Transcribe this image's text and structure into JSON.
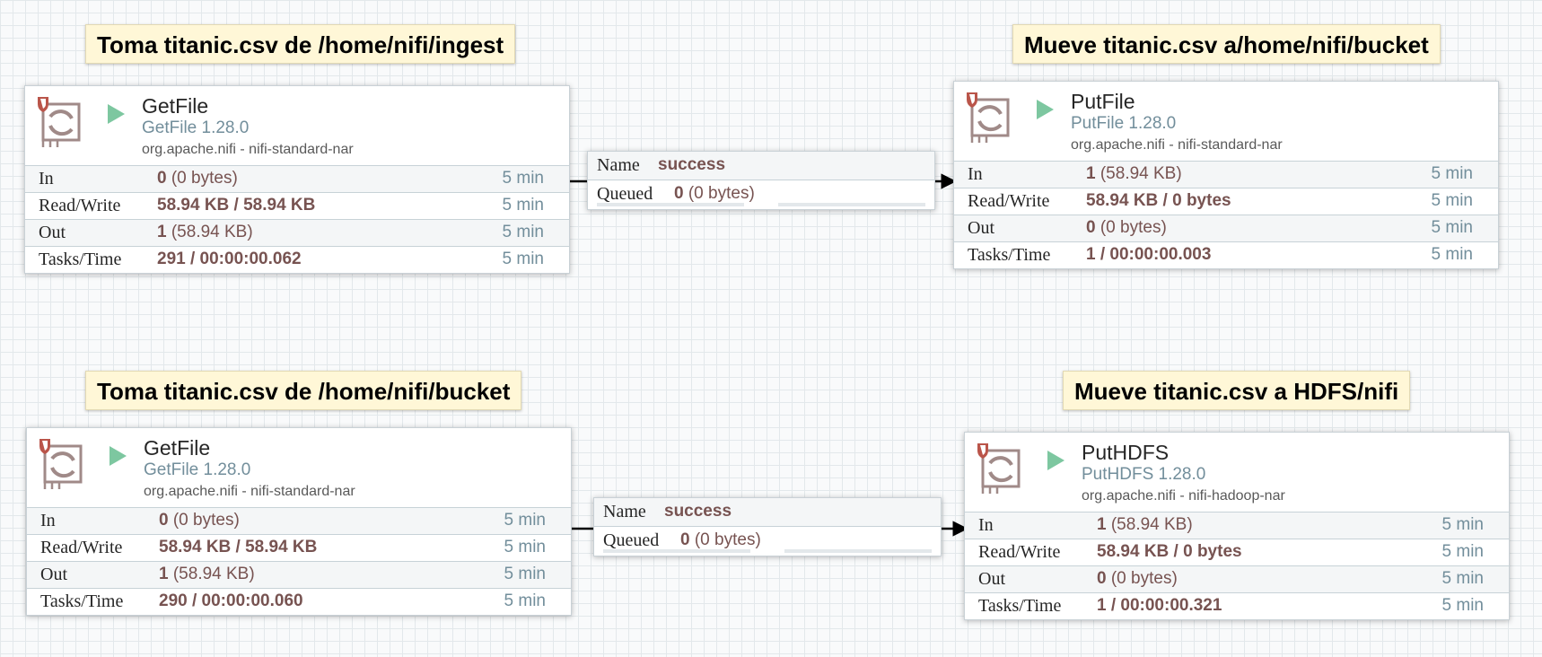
{
  "labels": [
    "Toma titanic.csv de /home/nifi/ingest",
    "Mueve titanic.csv a/home/nifi/bucket",
    "Toma titanic.csv de /home/nifi/bucket",
    "Mueve titanic.csv a HDFS/nifi"
  ],
  "processors": [
    {
      "name": "GetFile",
      "version": "GetFile 1.28.0",
      "bundle": "org.apache.nifi - nifi-standard-nar",
      "stats": [
        {
          "key": "In",
          "value": "0",
          "extra": " (0 bytes)",
          "time": "5 min"
        },
        {
          "key": "Read/Write",
          "value": "58.94 KB / 58.94 KB",
          "extra": "",
          "time": "5 min"
        },
        {
          "key": "Out",
          "value": "1",
          "extra": " (58.94 KB)",
          "time": "5 min"
        },
        {
          "key": "Tasks/Time",
          "value": "291 / 00:00:00.062",
          "extra": "",
          "time": "5 min"
        }
      ]
    },
    {
      "name": "PutFile",
      "version": "PutFile 1.28.0",
      "bundle": "org.apache.nifi - nifi-standard-nar",
      "stats": [
        {
          "key": "In",
          "value": "1",
          "extra": " (58.94 KB)",
          "time": "5 min"
        },
        {
          "key": "Read/Write",
          "value": "58.94 KB / 0 bytes",
          "extra": "",
          "time": "5 min"
        },
        {
          "key": "Out",
          "value": "0",
          "extra": " (0 bytes)",
          "time": "5 min"
        },
        {
          "key": "Tasks/Time",
          "value": "1 / 00:00:00.003",
          "extra": "",
          "time": "5 min"
        }
      ]
    },
    {
      "name": "GetFile",
      "version": "GetFile 1.28.0",
      "bundle": "org.apache.nifi - nifi-standard-nar",
      "stats": [
        {
          "key": "In",
          "value": "0",
          "extra": " (0 bytes)",
          "time": "5 min"
        },
        {
          "key": "Read/Write",
          "value": "58.94 KB / 58.94 KB",
          "extra": "",
          "time": "5 min"
        },
        {
          "key": "Out",
          "value": "1",
          "extra": " (58.94 KB)",
          "time": "5 min"
        },
        {
          "key": "Tasks/Time",
          "value": "290 / 00:00:00.060",
          "extra": "",
          "time": "5 min"
        }
      ]
    },
    {
      "name": "PutHDFS",
      "version": "PutHDFS 1.28.0",
      "bundle": "org.apache.nifi - nifi-hadoop-nar",
      "stats": [
        {
          "key": "In",
          "value": "1",
          "extra": " (58.94 KB)",
          "time": "5 min"
        },
        {
          "key": "Read/Write",
          "value": "58.94 KB / 0 bytes",
          "extra": "",
          "time": "5 min"
        },
        {
          "key": "Out",
          "value": "0",
          "extra": " (0 bytes)",
          "time": "5 min"
        },
        {
          "key": "Tasks/Time",
          "value": "1 / 00:00:00.321",
          "extra": "",
          "time": "5 min"
        }
      ]
    }
  ],
  "connections": [
    {
      "name_key": "Name",
      "name": "success",
      "queued_key": "Queued",
      "queued": "0",
      "queued_extra": " (0 bytes)"
    },
    {
      "name_key": "Name",
      "name": "success",
      "queued_key": "Queued",
      "queued": "0",
      "queued_extra": " (0 bytes)"
    }
  ],
  "colors": {
    "label_bg": "#fff7d7",
    "run_icon": "#7dc7a0",
    "value_text": "#775351",
    "secondary_text": "#728e9b"
  },
  "icons": [
    "processor-icon",
    "restricted-shield-icon",
    "run-status-icon",
    "arrow-head-icon"
  ]
}
